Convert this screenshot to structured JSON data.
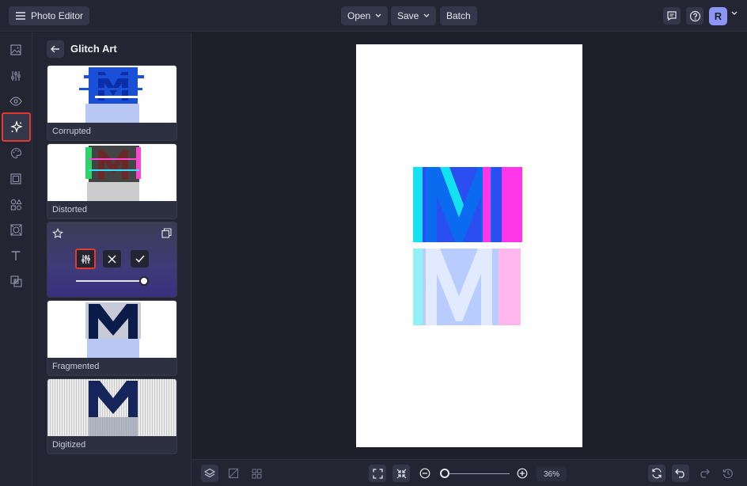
{
  "app": {
    "title": "Photo Editor"
  },
  "toolbar": {
    "open_label": "Open",
    "save_label": "Save",
    "batch_label": "Batch",
    "avatar_initial": "R"
  },
  "panel": {
    "title": "Glitch Art",
    "effects": [
      {
        "label": "Corrupted"
      },
      {
        "label": "Distorted"
      },
      {
        "label": "",
        "active": true,
        "intensity": 1.0
      },
      {
        "label": "Fragmented"
      },
      {
        "label": "Digitized"
      }
    ]
  },
  "zoom": {
    "value_label": "36%",
    "slider_fraction": 0.0
  },
  "colors": {
    "accent_highlight": "#e23b2e",
    "avatar": "#8e96f5",
    "bg": "#1d1f2a",
    "panel": "#232532"
  }
}
